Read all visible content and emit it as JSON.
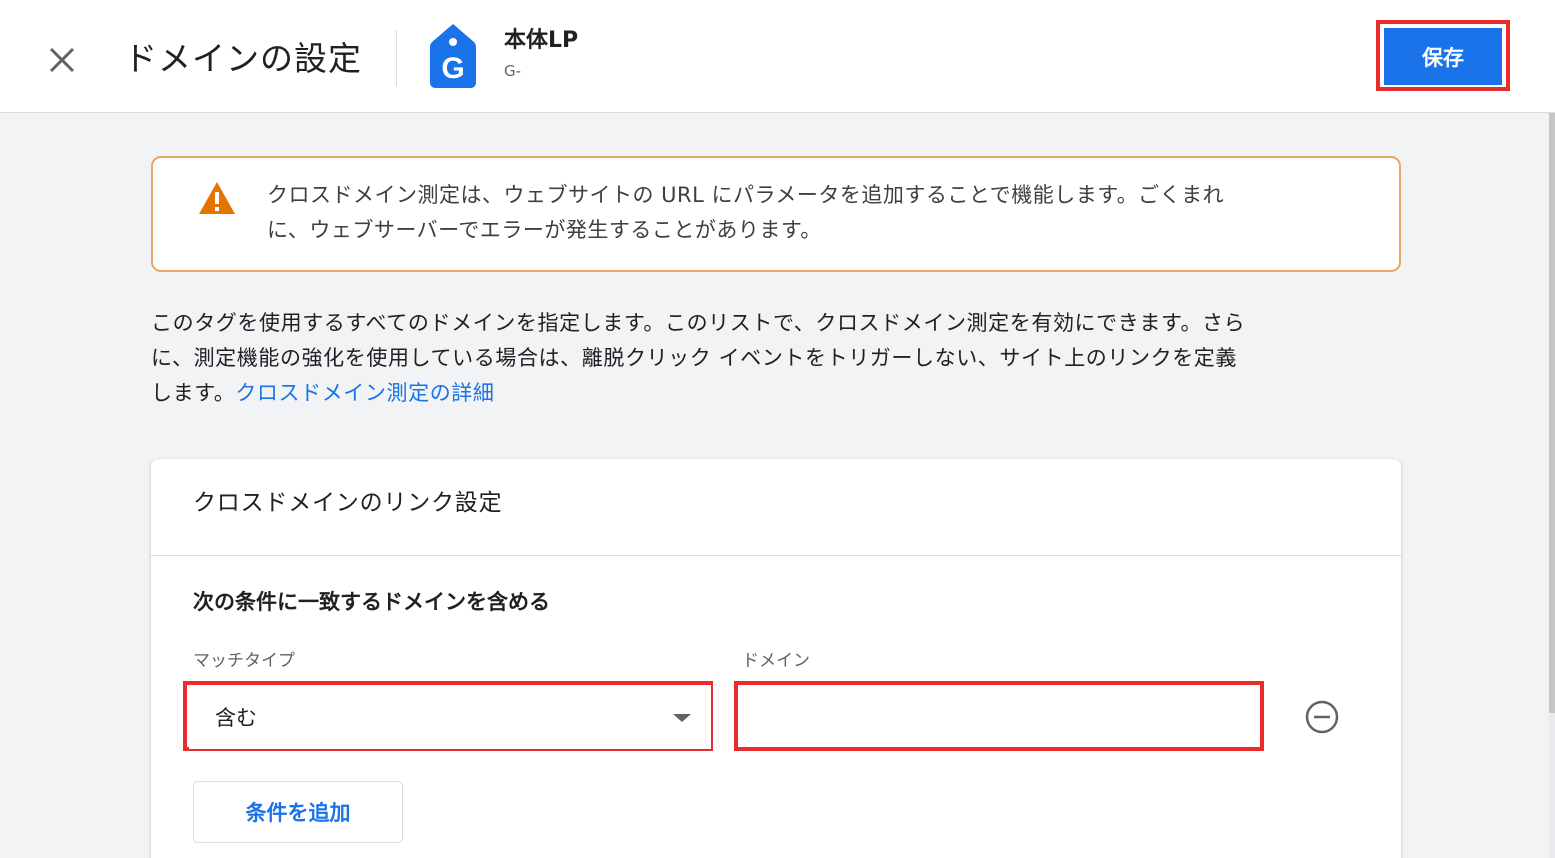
{
  "header": {
    "title": "ドメインの設定",
    "tag_name": "本体LP",
    "tag_id": "G-",
    "tag_icon_letter": "G",
    "save_label": "保存"
  },
  "warning": {
    "line1": "クロスドメイン測定は、ウェブサイトの URL にパラメータを追加することで機能します。ごくまれ",
    "line2": "に、ウェブサーバーでエラーが発生することがあります。"
  },
  "description": {
    "line1": "このタグを使用するすべてのドメインを指定します。このリストで、クロスドメイン測定を有効にできます。さら",
    "line2": "に、測定機能の強化を使用している場合は、離脱クリック イベントをトリガーしない、サイト上のリンクを定義",
    "line3": "します。",
    "link": "クロスドメイン測定の詳細"
  },
  "card": {
    "title": "クロスドメインのリンク設定",
    "condition_heading": "次の条件に一致するドメインを含める",
    "match_type_label": "マッチタイプ",
    "match_type_value": "含む",
    "domain_label": "ドメイン",
    "domain_value": "",
    "add_condition_label": "条件を追加"
  },
  "colors": {
    "accent": "#1a73e8",
    "highlight": "#ea2c2c",
    "warning_border": "#e8a765",
    "warning_icon": "#e37400"
  },
  "icons": {
    "close": "close-icon",
    "tag": "tag-icon",
    "warning": "warning-icon",
    "dropdown": "dropdown-arrow-icon",
    "remove": "remove-circle-icon"
  }
}
